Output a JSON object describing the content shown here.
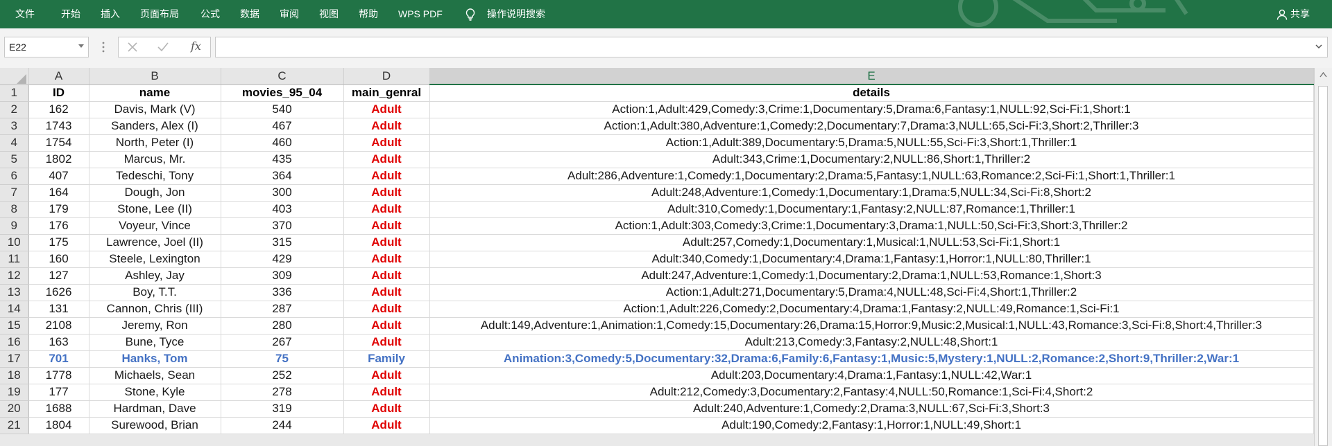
{
  "menu": {
    "file": "文件",
    "home": "开始",
    "insert": "插入",
    "page_layout": "页面布局",
    "formulas": "公式",
    "data": "数据",
    "review": "审阅",
    "view": "视图",
    "help": "帮助",
    "wps_pdf": "WPS PDF",
    "tell_me": "操作说明搜索",
    "share": "共享"
  },
  "formula_bar": {
    "cell_ref": "E22",
    "formula_value": "",
    "fx_label": "fx"
  },
  "columns": [
    "A",
    "B",
    "C",
    "D",
    "E"
  ],
  "header_row": {
    "row_number": "1",
    "id": "ID",
    "name": "name",
    "movies": "movies_95_04",
    "genre": "main_genral",
    "details": "details"
  },
  "rows": [
    {
      "row": "2",
      "id": "162",
      "name": "Davis, Mark (V)",
      "movies": "540",
      "genre": "Adult",
      "details": "Action:1,Adult:429,Comedy:3,Crime:1,Documentary:5,Drama:6,Fantasy:1,NULL:92,Sci-Fi:1,Short:1"
    },
    {
      "row": "3",
      "id": "1743",
      "name": "Sanders, Alex (I)",
      "movies": "467",
      "genre": "Adult",
      "details": "Action:1,Adult:380,Adventure:1,Comedy:2,Documentary:7,Drama:3,NULL:65,Sci-Fi:3,Short:2,Thriller:3"
    },
    {
      "row": "4",
      "id": "1754",
      "name": "North, Peter (I)",
      "movies": "460",
      "genre": "Adult",
      "details": "Action:1,Adult:389,Documentary:5,Drama:5,NULL:55,Sci-Fi:3,Short:1,Thriller:1"
    },
    {
      "row": "5",
      "id": "1802",
      "name": "Marcus, Mr.",
      "movies": "435",
      "genre": "Adult",
      "details": "Adult:343,Crime:1,Documentary:2,NULL:86,Short:1,Thriller:2"
    },
    {
      "row": "6",
      "id": "407",
      "name": "Tedeschi, Tony",
      "movies": "364",
      "genre": "Adult",
      "details": "Adult:286,Adventure:1,Comedy:1,Documentary:2,Drama:5,Fantasy:1,NULL:63,Romance:2,Sci-Fi:1,Short:1,Thriller:1"
    },
    {
      "row": "7",
      "id": "164",
      "name": "Dough, Jon",
      "movies": "300",
      "genre": "Adult",
      "details": "Adult:248,Adventure:1,Comedy:1,Documentary:1,Drama:5,NULL:34,Sci-Fi:8,Short:2"
    },
    {
      "row": "8",
      "id": "179",
      "name": "Stone, Lee (II)",
      "movies": "403",
      "genre": "Adult",
      "details": "Adult:310,Comedy:1,Documentary:1,Fantasy:2,NULL:87,Romance:1,Thriller:1"
    },
    {
      "row": "9",
      "id": "176",
      "name": "Voyeur, Vince",
      "movies": "370",
      "genre": "Adult",
      "details": "Action:1,Adult:303,Comedy:3,Crime:1,Documentary:3,Drama:1,NULL:50,Sci-Fi:3,Short:3,Thriller:2"
    },
    {
      "row": "10",
      "id": "175",
      "name": "Lawrence, Joel (II)",
      "movies": "315",
      "genre": "Adult",
      "details": "Adult:257,Comedy:1,Documentary:1,Musical:1,NULL:53,Sci-Fi:1,Short:1"
    },
    {
      "row": "11",
      "id": "160",
      "name": "Steele, Lexington",
      "movies": "429",
      "genre": "Adult",
      "details": "Adult:340,Comedy:1,Documentary:4,Drama:1,Fantasy:1,Horror:1,NULL:80,Thriller:1"
    },
    {
      "row": "12",
      "id": "127",
      "name": "Ashley, Jay",
      "movies": "309",
      "genre": "Adult",
      "details": "Adult:247,Adventure:1,Comedy:1,Documentary:2,Drama:1,NULL:53,Romance:1,Short:3"
    },
    {
      "row": "13",
      "id": "1626",
      "name": "Boy, T.T.",
      "movies": "336",
      "genre": "Adult",
      "details": "Action:1,Adult:271,Documentary:5,Drama:4,NULL:48,Sci-Fi:4,Short:1,Thriller:2"
    },
    {
      "row": "14",
      "id": "131",
      "name": "Cannon, Chris (III)",
      "movies": "287",
      "genre": "Adult",
      "details": "Action:1,Adult:226,Comedy:2,Documentary:4,Drama:1,Fantasy:2,NULL:49,Romance:1,Sci-Fi:1"
    },
    {
      "row": "15",
      "id": "2108",
      "name": "Jeremy, Ron",
      "movies": "280",
      "genre": "Adult",
      "details": "Adult:149,Adventure:1,Animation:1,Comedy:15,Documentary:26,Drama:15,Horror:9,Music:2,Musical:1,NULL:43,Romance:3,Sci-Fi:8,Short:4,Thriller:3"
    },
    {
      "row": "16",
      "id": "163",
      "name": "Bune, Tyce",
      "movies": "267",
      "genre": "Adult",
      "details": "Adult:213,Comedy:3,Fantasy:2,NULL:48,Short:1"
    },
    {
      "row": "17",
      "id": "701",
      "name": "Hanks, Tom",
      "movies": "75",
      "genre": "Family",
      "details": "Animation:3,Comedy:5,Documentary:32,Drama:6,Family:6,Fantasy:1,Music:5,Mystery:1,NULL:2,Romance:2,Short:9,Thriller:2,War:1",
      "highlight": true
    },
    {
      "row": "18",
      "id": "1778",
      "name": "Michaels, Sean",
      "movies": "252",
      "genre": "Adult",
      "details": "Adult:203,Documentary:4,Drama:1,Fantasy:1,NULL:42,War:1"
    },
    {
      "row": "19",
      "id": "177",
      "name": "Stone, Kyle",
      "movies": "278",
      "genre": "Adult",
      "details": "Adult:212,Comedy:3,Documentary:2,Fantasy:4,NULL:50,Romance:1,Sci-Fi:4,Short:2"
    },
    {
      "row": "20",
      "id": "1688",
      "name": "Hardman, Dave",
      "movies": "319",
      "genre": "Adult",
      "details": "Adult:240,Adventure:1,Comedy:2,Drama:3,NULL:67,Sci-Fi:3,Short:3"
    },
    {
      "row": "21",
      "id": "1804",
      "name": "Surewood, Brian",
      "movies": "244",
      "genre": "Adult",
      "details": "Adult:190,Comedy:2,Fantasy:1,Horror:1,NULL:49,Short:1"
    }
  ],
  "colors": {
    "ribbon": "#217346",
    "genre_text": "#e00000",
    "highlight_row": "#4472c4"
  }
}
